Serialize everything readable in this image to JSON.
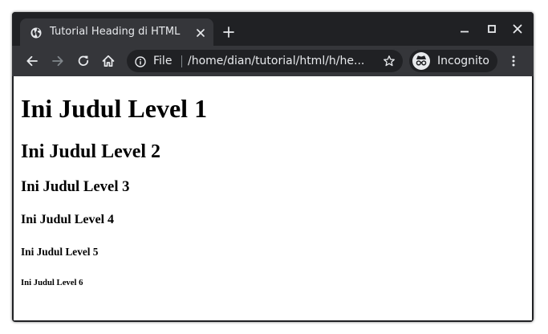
{
  "browser": {
    "tab": {
      "title": "Tutorial Heading di HTML",
      "favicon": "globe-icon"
    },
    "window_controls": [
      "minimize-icon",
      "maximize-icon",
      "close-icon"
    ],
    "toolbar": {
      "buttons": [
        "back-arrow-icon",
        "forward-arrow-icon",
        "reload-icon",
        "home-icon"
      ],
      "address": {
        "scheme_label": "File",
        "url": "/home/dian/tutorial/html/h/he..."
      },
      "profile_label": "Incognito",
      "menu_icon": "kebab-menu-icon"
    },
    "colors": {
      "frame": "#202124",
      "toolbar": "#35363a",
      "text": "#e8eaed",
      "forward_disabled": "#80868b"
    }
  },
  "page": {
    "headings": {
      "h1": "Ini Judul Level 1",
      "h2": "Ini Judul Level 2",
      "h3": "Ini Judul Level 3",
      "h4": "Ini Judul Level 4",
      "h5": "Ini Judul Level 5",
      "h6": "Ini Judul Level 6"
    }
  }
}
